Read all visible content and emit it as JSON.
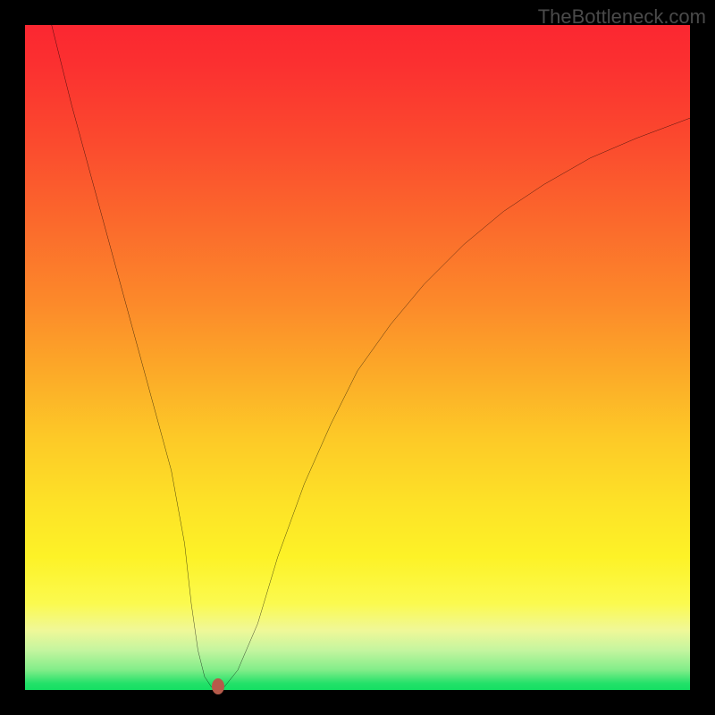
{
  "watermark": "TheBottleneck.com",
  "chart_data": {
    "type": "line",
    "title": "",
    "xlabel": "",
    "ylabel": "",
    "xlim": [
      0,
      100
    ],
    "ylim": [
      0,
      100
    ],
    "grid": false,
    "legend": false,
    "background_gradient_top": "#fb2731",
    "background_gradient_bottom": "#14df63",
    "series": [
      {
        "name": "bottleneck-curve",
        "color": "#000000",
        "x": [
          4,
          7,
          10,
          13,
          16,
          19,
          22,
          24,
          25,
          26,
          27,
          28,
          29,
          30,
          32,
          35,
          38,
          42,
          46,
          50,
          55,
          60,
          66,
          72,
          78,
          85,
          92,
          100
        ],
        "y": [
          100,
          88,
          77,
          66,
          55,
          44,
          33,
          22,
          13,
          6,
          2,
          0.5,
          0.5,
          0.5,
          3,
          10,
          20,
          31,
          40,
          48,
          55,
          61,
          67,
          72,
          76,
          80,
          83,
          86
        ]
      }
    ],
    "marker": {
      "name": "optimal-point",
      "x": 29,
      "y": 0.5,
      "color": "#b65a4a"
    }
  }
}
